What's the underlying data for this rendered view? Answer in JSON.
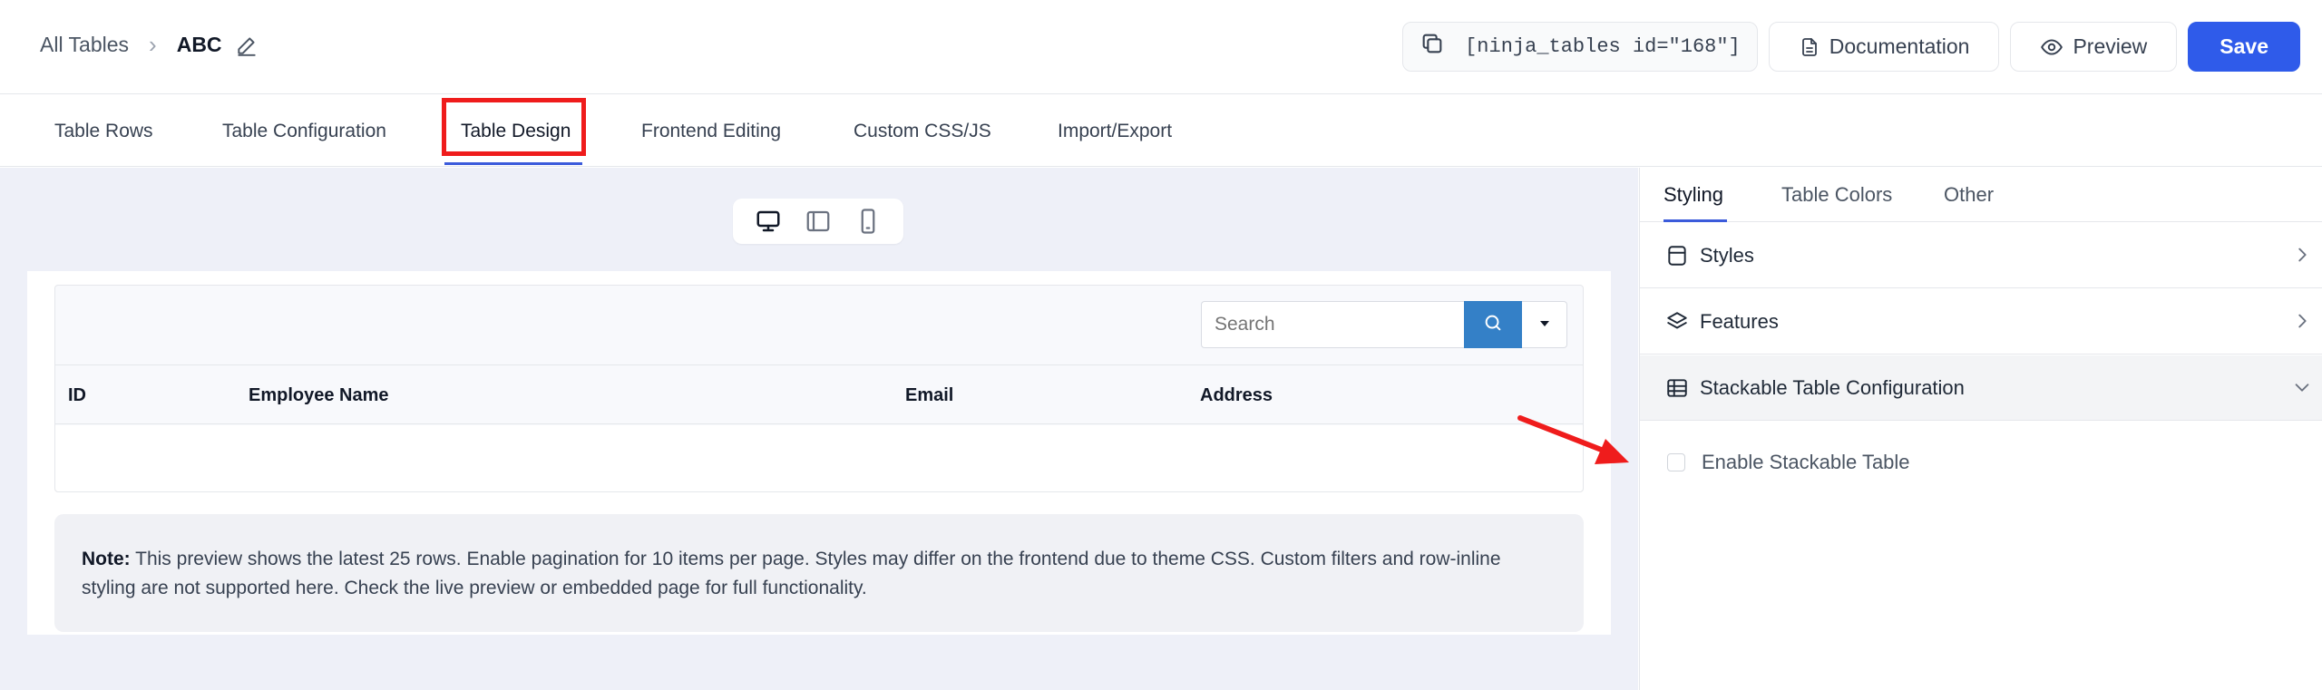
{
  "header": {
    "breadcrumb_root": "All Tables",
    "breadcrumb_sep": "›",
    "table_name": "ABC",
    "shortcode": "[ninja_tables id=\"168\"]",
    "documentation_label": "Documentation",
    "preview_label": "Preview",
    "save_label": "Save"
  },
  "tabs": [
    {
      "label": "Table Rows"
    },
    {
      "label": "Table Configuration"
    },
    {
      "label": "Table Design",
      "active": true
    },
    {
      "label": "Frontend Editing"
    },
    {
      "label": "Custom CSS/JS"
    },
    {
      "label": "Import/Export"
    }
  ],
  "preview": {
    "device_modes": [
      "desktop-icon",
      "tablet-icon",
      "mobile-icon"
    ],
    "search_placeholder": "Search",
    "columns": [
      "ID",
      "Employee Name",
      "Email",
      "Address"
    ],
    "rows": [],
    "note_label": "Note:",
    "note_text": " This preview shows the latest 25 rows. Enable pagination for 10 items per page. Styles may differ on the frontend due to theme CSS. Custom filters and row-inline styling are not supported here. Check the live preview or embedded page for full functionality."
  },
  "sidebar": {
    "tabs": [
      {
        "label": "Styling",
        "active": true
      },
      {
        "label": "Table Colors"
      },
      {
        "label": "Other"
      }
    ],
    "sections": [
      {
        "label": "Styles",
        "icon": "database-icon",
        "expanded": false
      },
      {
        "label": "Features",
        "icon": "layers-icon",
        "expanded": false
      },
      {
        "label": "Stackable Table Configuration",
        "icon": "table-icon",
        "expanded": true
      }
    ],
    "enable_stackable_label": "Enable Stackable Table",
    "enable_stackable_checked": false
  },
  "colors": {
    "accent": "#2f5bea",
    "search_button": "#3480c7",
    "annotation_red": "#ef1c1c"
  }
}
